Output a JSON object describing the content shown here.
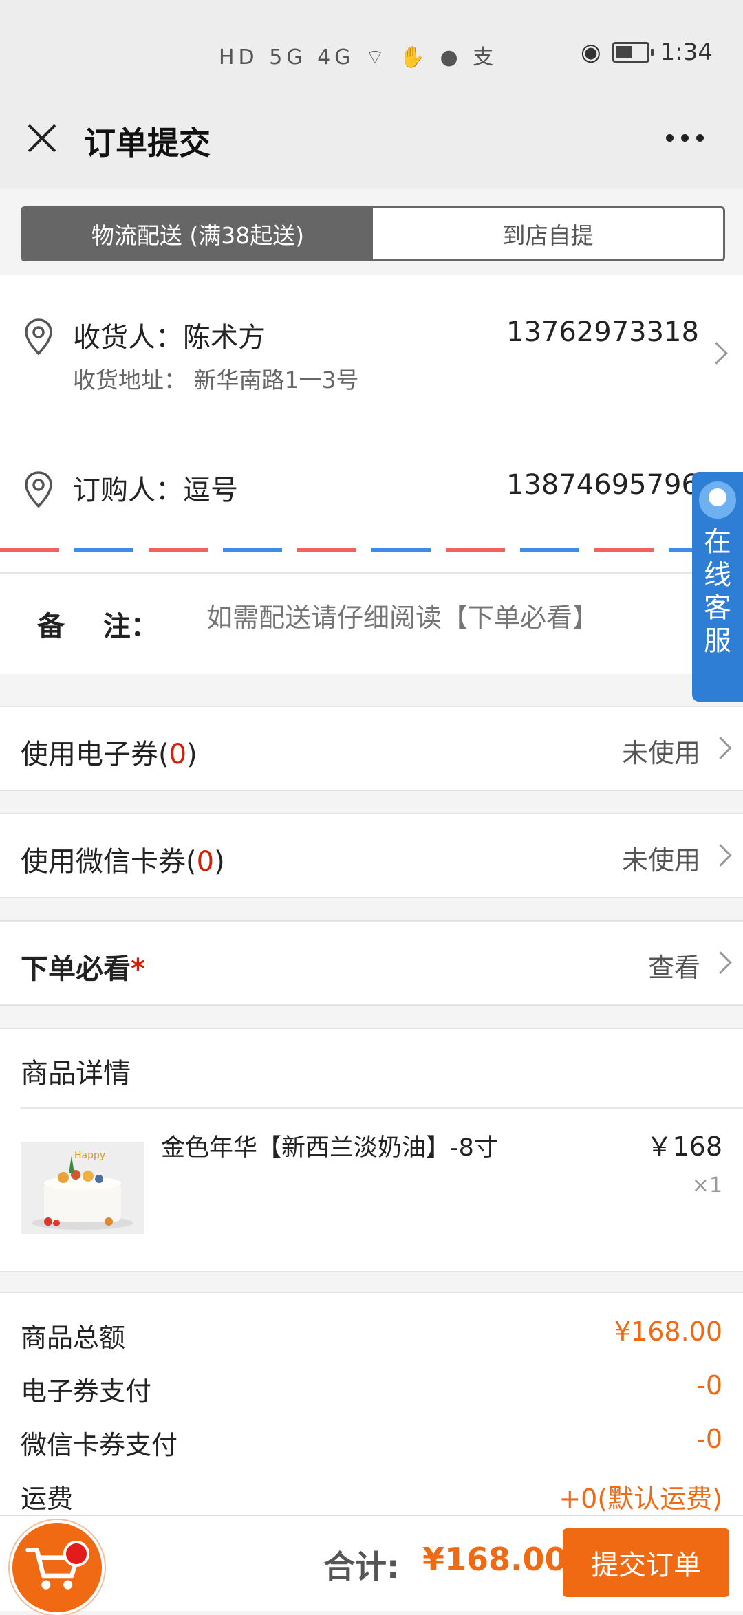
{
  "status_bar": {
    "left_icons": "HD 5G 4G ⌔ ✋ ● 支",
    "time": "1:34"
  },
  "header": {
    "title": "订单提交"
  },
  "delivery_tabs": [
    {
      "label": "物流配送 (满38起送)",
      "active": true
    },
    {
      "label": "到店自提",
      "active": false
    }
  ],
  "recipient": {
    "name_label": "收货人：陈术方",
    "phone": "13762973318",
    "address_label": "收货地址：  新华南路1一3号"
  },
  "buyer": {
    "name_label": "订购人：逗号",
    "phone": "13874695796"
  },
  "remark": {
    "label": "备    注：",
    "placeholder": "如需配送请仔细阅读【下单必看】"
  },
  "options": [
    {
      "label": "使用电子券(",
      "count": "0",
      "suffix": ")",
      "value": "未使用"
    },
    {
      "label": "使用微信卡券(",
      "count": "0",
      "suffix": ")",
      "value": "未使用"
    },
    {
      "label": "下单必看",
      "star": "*",
      "value": "查看"
    }
  ],
  "product_section": {
    "title": "商品详情",
    "items": [
      {
        "name": "金色年华【新西兰淡奶油】-8寸",
        "price": "￥168",
        "qty": "×1"
      }
    ]
  },
  "summary": [
    {
      "label": "商品总额",
      "value": "¥168.00"
    },
    {
      "label": "电子券支付",
      "value": "-0"
    },
    {
      "label": "微信卡券支付",
      "value": "-0"
    },
    {
      "label": "运费",
      "value": "+0(默认运费)"
    }
  ],
  "footer": {
    "total_label": "合计:",
    "total_value": "¥168.00",
    "submit_label": "提交订单"
  },
  "service_widget": {
    "label": "在线客服"
  },
  "colors": {
    "accent": "#f06a14",
    "tab_active": "#666666",
    "service_blue": "#2f7ed6",
    "red": "#d81e06"
  },
  "icons": [
    "close-icon",
    "more-icon",
    "location-icon",
    "chevron-right-icon",
    "cart-icon"
  ]
}
